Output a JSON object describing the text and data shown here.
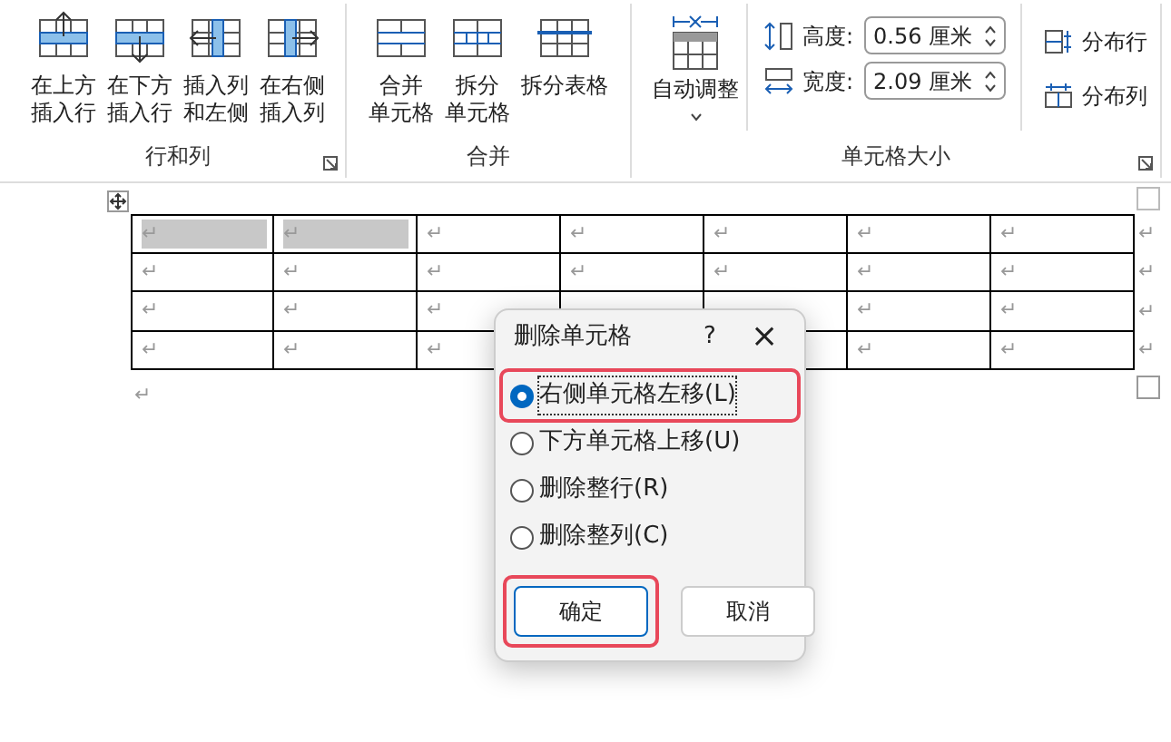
{
  "ribbon": {
    "groups": [
      {
        "label": "行和列",
        "launcher": true,
        "buttons": [
          {
            "kind": "insert-above",
            "line1": "在上方",
            "line2": "插入行"
          },
          {
            "kind": "insert-below",
            "line1": "在下方",
            "line2": "插入行"
          },
          {
            "kind": "insert-left",
            "line1": "插入列",
            "line2": "和左侧"
          },
          {
            "kind": "insert-right",
            "line1": "在右侧",
            "line2": "插入列"
          }
        ]
      },
      {
        "label": "合并",
        "launcher": false,
        "buttons": [
          {
            "kind": "merge",
            "line1": "合并",
            "line2": "单元格"
          },
          {
            "kind": "split",
            "line1": "拆分",
            "line2": "单元格"
          },
          {
            "kind": "split-table",
            "line1": "拆分表格"
          }
        ]
      },
      {
        "label": "单元格大小",
        "launcher": true,
        "autofit": {
          "label": "自动调整"
        },
        "height": {
          "label": "高度:",
          "value": "0.56 厘米"
        },
        "width": {
          "label": "宽度:",
          "value": "2.09 厘米"
        },
        "distribute_rows": "分布行",
        "distribute_cols": "分布列"
      }
    ]
  },
  "table": {
    "rows": [
      {
        "end_mark": "↵",
        "cells": [
          {
            "mark": "↵",
            "selected": true
          },
          {
            "mark": "↵",
            "selected": true
          },
          {
            "mark": "↵",
            "selected": false
          },
          {
            "mark": "↵",
            "selected": false
          },
          {
            "mark": "↵",
            "selected": false
          },
          {
            "mark": "↵",
            "selected": false
          },
          {
            "mark": "↵",
            "selected": false
          }
        ]
      },
      {
        "end_mark": "↵",
        "cells": [
          {
            "mark": "↵",
            "selected": false
          },
          {
            "mark": "↵",
            "selected": false
          },
          {
            "mark": "↵",
            "selected": false
          },
          {
            "mark": "↵",
            "selected": false
          },
          {
            "mark": "↵",
            "selected": false
          },
          {
            "mark": "↵",
            "selected": false
          },
          {
            "mark": "↵",
            "selected": false
          }
        ]
      },
      {
        "end_mark": "↵",
        "cells": [
          {
            "mark": "↵",
            "selected": false
          },
          {
            "mark": "↵",
            "selected": false
          },
          {
            "mark": "↵",
            "selected": false
          },
          {
            "selected": false
          },
          {
            "selected": false
          },
          {
            "mark": "↵",
            "selected": false
          },
          {
            "mark": "↵",
            "selected": false
          }
        ]
      },
      {
        "end_mark": "↵",
        "cells": [
          {
            "mark": "↵",
            "selected": false
          },
          {
            "mark": "↵",
            "selected": false
          },
          {
            "mark": "↵",
            "selected": false
          },
          {},
          {
            "selected": false
          },
          {
            "mark": "↵",
            "selected": false
          },
          {
            "mark": "↵",
            "selected": false
          }
        ]
      }
    ],
    "after_mark": "↵"
  },
  "dialog": {
    "title": "删除单元格",
    "help": "?",
    "close": "×",
    "options": [
      {
        "label": "右侧单元格左移(L)",
        "selected": true,
        "highlighted": true
      },
      {
        "label": "下方单元格上移(U)",
        "selected": false,
        "highlighted": false
      },
      {
        "label": "删除整行(R)",
        "selected": false,
        "highlighted": false
      },
      {
        "label": "删除整列(C)",
        "selected": false,
        "highlighted": false
      }
    ],
    "buttons": [
      {
        "label": "确定",
        "primary": true,
        "highlighted": true
      },
      {
        "label": "取消",
        "primary": false,
        "highlighted": false
      }
    ]
  }
}
